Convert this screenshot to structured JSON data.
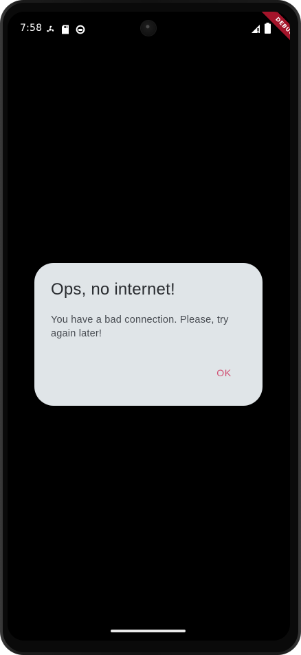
{
  "status_bar": {
    "time": "7:58",
    "left_icons": [
      "fan-icon",
      "sd-card-icon",
      "sync-icon"
    ],
    "right_icons": [
      "signal-icon",
      "battery-icon"
    ]
  },
  "debug_banner": "DEBUG",
  "dialog": {
    "title": "Ops, no internet!",
    "message": "You have a bad connection. Please, try again later!",
    "ok_label": "OK"
  },
  "colors": {
    "background": "#000000",
    "dialog": "#e0e5e8",
    "accent": "#d14f72",
    "debug_banner": "#a4142a"
  }
}
